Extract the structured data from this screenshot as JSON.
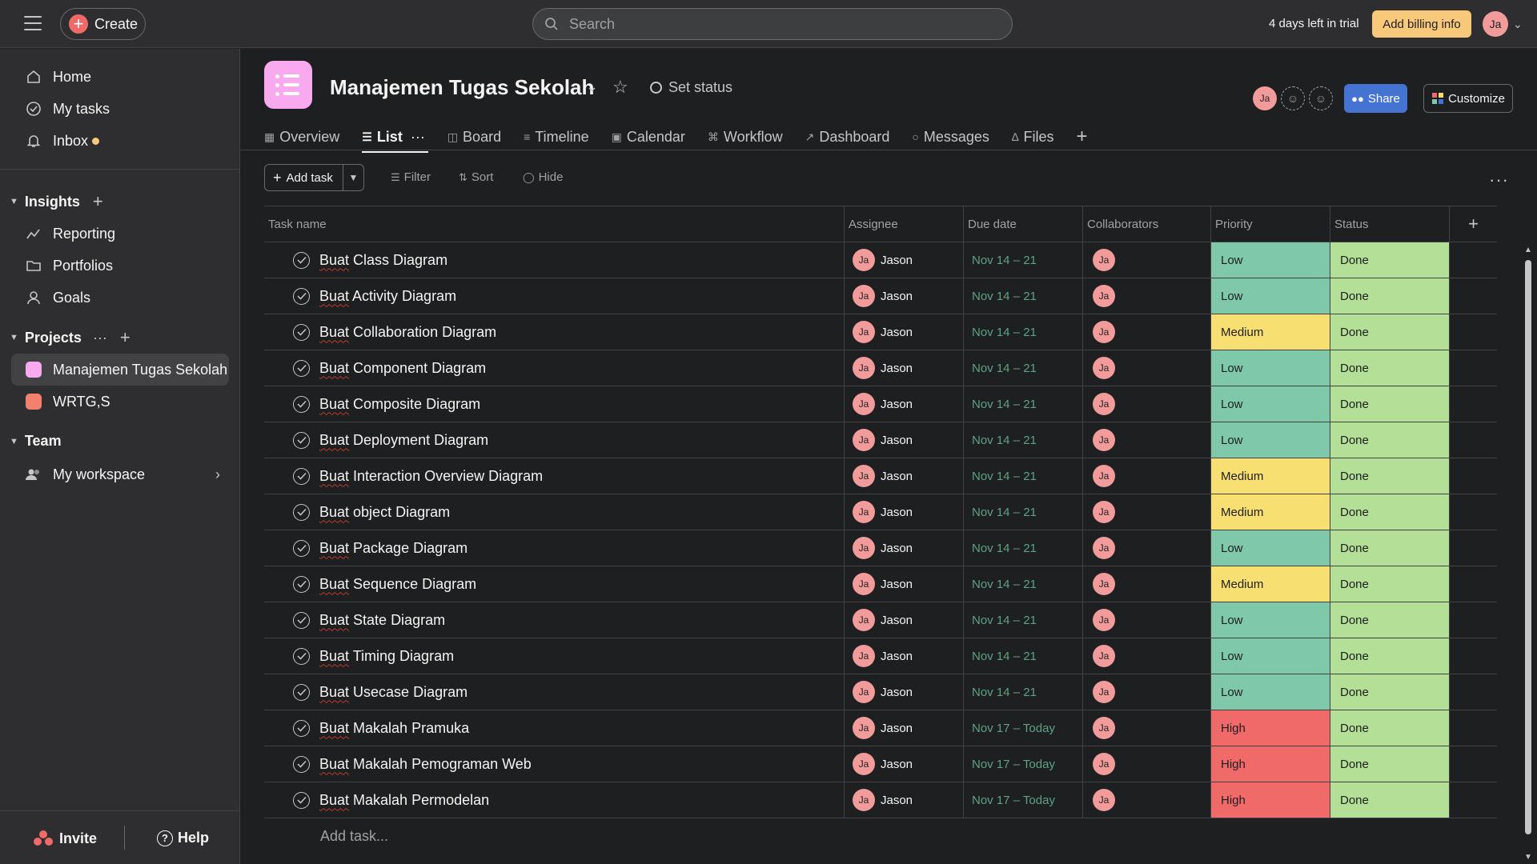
{
  "topbar": {
    "create_label": "Create",
    "search_placeholder": "Search",
    "trial_text": "4 days left in trial",
    "billing_label": "Add billing info",
    "user_initials": "Ja"
  },
  "sidebar": {
    "nav": [
      {
        "label": "Home",
        "icon": "home-icon"
      },
      {
        "label": "My tasks",
        "icon": "check-circle-icon"
      },
      {
        "label": "Inbox",
        "icon": "bell-icon"
      }
    ],
    "insights_label": "Insights",
    "insights_items": [
      {
        "label": "Reporting",
        "icon": "reporting-icon"
      },
      {
        "label": "Portfolios",
        "icon": "folder-icon"
      },
      {
        "label": "Goals",
        "icon": "goals-icon"
      }
    ],
    "projects_label": "Projects",
    "projects": [
      {
        "label": "Manajemen Tugas Sekolah",
        "color": "#f9aaef"
      },
      {
        "label": "WRTG,S",
        "color": "#f1816d"
      }
    ],
    "team_label": "Team",
    "team_item": "My workspace",
    "invite_label": "Invite",
    "help_label": "Help"
  },
  "header": {
    "title": "Manajemen Tugas Sekolah",
    "set_status": "Set status",
    "member_initials": "Ja",
    "share_label": "Share",
    "customize_label": "Customize",
    "tabs": [
      "Overview",
      "List",
      "Board",
      "Timeline",
      "Calendar",
      "Workflow",
      "Dashboard",
      "Messages",
      "Files"
    ]
  },
  "toolbar": {
    "add_task_label": "Add task",
    "filter_label": "Filter",
    "sort_label": "Sort",
    "hide_label": "Hide"
  },
  "table": {
    "columns": [
      "Task name",
      "Assignee",
      "Due date",
      "Collaborators",
      "Priority",
      "Status"
    ],
    "add_task_row": "Add task...",
    "colors": {
      "Low": "#7fc8a9",
      "Medium": "#f8df72",
      "High": "#f06a6a",
      "Done": "#b3df97"
    },
    "rows": [
      {
        "name": "Buat Class Diagram",
        "assignee": "Jason",
        "initials": "Ja",
        "due": "Nov 14 – 21",
        "priority": "Low",
        "status": "Done"
      },
      {
        "name": "Buat Activity Diagram",
        "assignee": "Jason",
        "initials": "Ja",
        "due": "Nov 14 – 21",
        "priority": "Low",
        "status": "Done"
      },
      {
        "name": "Buat Collaboration Diagram",
        "assignee": "Jason",
        "initials": "Ja",
        "due": "Nov 14 – 21",
        "priority": "Medium",
        "status": "Done"
      },
      {
        "name": "Buat Component Diagram",
        "assignee": "Jason",
        "initials": "Ja",
        "due": "Nov 14 – 21",
        "priority": "Low",
        "status": "Done"
      },
      {
        "name": "Buat Composite Diagram",
        "assignee": "Jason",
        "initials": "Ja",
        "due": "Nov 14 – 21",
        "priority": "Low",
        "status": "Done"
      },
      {
        "name": "Buat Deployment Diagram",
        "assignee": "Jason",
        "initials": "Ja",
        "due": "Nov 14 – 21",
        "priority": "Low",
        "status": "Done"
      },
      {
        "name": "Buat Interaction Overview Diagram",
        "assignee": "Jason",
        "initials": "Ja",
        "due": "Nov 14 – 21",
        "priority": "Medium",
        "status": "Done"
      },
      {
        "name": "Buat object Diagram",
        "assignee": "Jason",
        "initials": "Ja",
        "due": "Nov 14 – 21",
        "priority": "Medium",
        "status": "Done"
      },
      {
        "name": "Buat Package Diagram",
        "assignee": "Jason",
        "initials": "Ja",
        "due": "Nov 14 – 21",
        "priority": "Low",
        "status": "Done"
      },
      {
        "name": "Buat Sequence Diagram",
        "assignee": "Jason",
        "initials": "Ja",
        "due": "Nov 14 – 21",
        "priority": "Medium",
        "status": "Done"
      },
      {
        "name": "Buat State Diagram",
        "assignee": "Jason",
        "initials": "Ja",
        "due": "Nov 14 – 21",
        "priority": "Low",
        "status": "Done"
      },
      {
        "name": "Buat Timing Diagram",
        "assignee": "Jason",
        "initials": "Ja",
        "due": "Nov 14 – 21",
        "priority": "Low",
        "status": "Done"
      },
      {
        "name": "Buat Usecase Diagram",
        "assignee": "Jason",
        "initials": "Ja",
        "due": "Nov 14 – 21",
        "priority": "Low",
        "status": "Done"
      },
      {
        "name": "Buat Makalah Pramuka",
        "assignee": "Jason",
        "initials": "Ja",
        "due": "Nov 17 – Today",
        "priority": "High",
        "status": "Done"
      },
      {
        "name": "Buat Makalah Pemograman Web",
        "assignee": "Jason",
        "initials": "Ja",
        "due": "Nov 17 – Today",
        "priority": "High",
        "status": "Done"
      },
      {
        "name": "Buat Makalah Permodelan",
        "assignee": "Jason",
        "initials": "Ja",
        "due": "Nov 17 – Today",
        "priority": "High",
        "status": "Done"
      }
    ]
  }
}
